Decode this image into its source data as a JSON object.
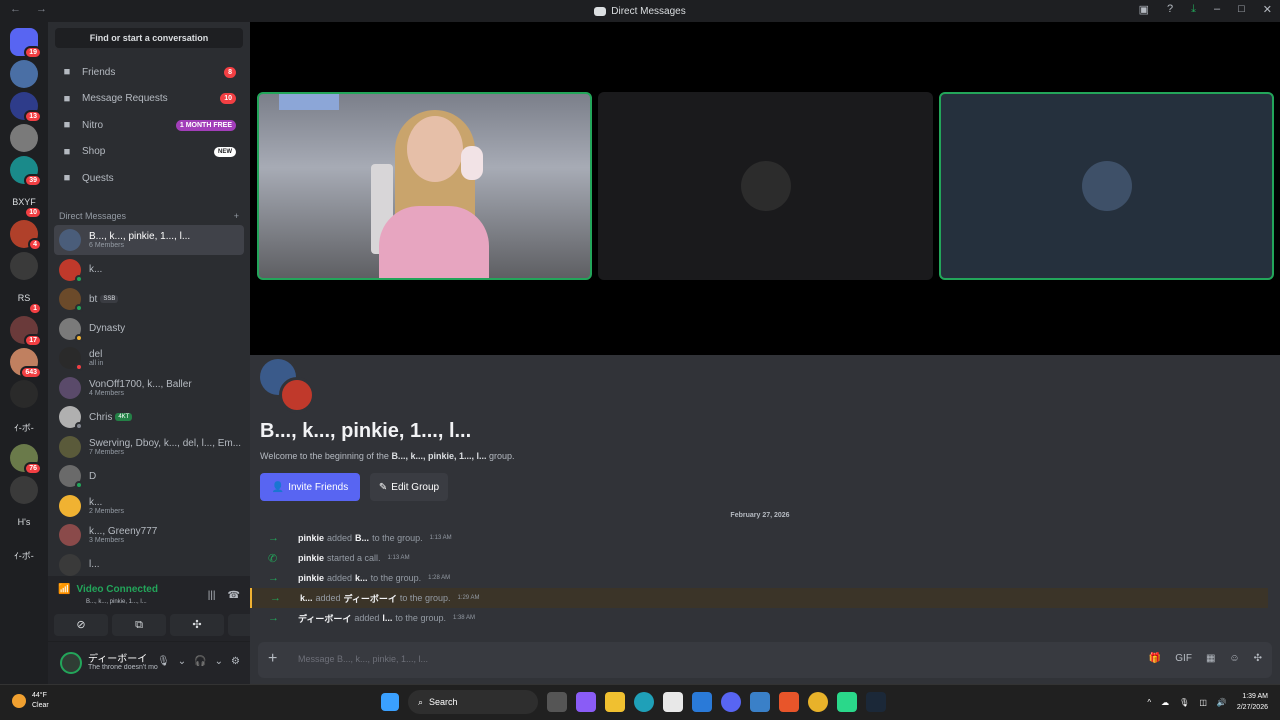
{
  "window": {
    "title": "Direct Messages"
  },
  "servers": [
    {
      "badge": "19"
    },
    {
      "badge": ""
    },
    {
      "badge": "13"
    },
    {
      "badge": ""
    },
    {
      "badge": "39"
    },
    {
      "text": "BXYF",
      "badge": "10"
    },
    {
      "badge": "4"
    },
    {
      "badge": ""
    },
    {
      "text": "RS",
      "badge": "1"
    },
    {
      "badge": "17"
    },
    {
      "badge": "643"
    },
    {
      "badge": ""
    },
    {
      "text": "ｲ-ボ-"
    },
    {
      "badge": "76"
    },
    {
      "badge": ""
    },
    {
      "text": "H's"
    },
    {
      "text": "ｲ-ボ-"
    }
  ],
  "sidebar": {
    "search": "Find or start a conversation",
    "nav": [
      {
        "label": "Friends",
        "badge": "8",
        "badge_type": "red",
        "icon": "friends-icon"
      },
      {
        "label": "Message Requests",
        "badge": "10",
        "badge_type": "red",
        "icon": "mail-icon"
      },
      {
        "label": "Nitro",
        "badge": "1 MONTH FREE",
        "badge_type": "purple",
        "icon": "nitro-icon"
      },
      {
        "label": "Shop",
        "badge": "NEW",
        "badge_type": "white",
        "icon": "shop-icon"
      },
      {
        "label": "Quests",
        "badge": "",
        "badge_type": "",
        "icon": "quests-icon"
      }
    ],
    "dm_header": "Direct Messages",
    "dms": [
      {
        "name": "B..., k..., pinkie, 1..., l...",
        "sub": "6 Members",
        "color": "#4a5d7a",
        "status": "",
        "tag": "",
        "active": true
      },
      {
        "name": "k...",
        "sub": "",
        "color": "#c0392b",
        "status": "#23a55a",
        "tag": ""
      },
      {
        "name": "bt",
        "sub": "",
        "color": "#6b4a2a",
        "status": "#23a55a",
        "tag": "SSB"
      },
      {
        "name": "Dynasty",
        "sub": "",
        "color": "#7a7a7a",
        "status": "#f0b232",
        "tag": ""
      },
      {
        "name": "del",
        "sub": "all in",
        "color": "#2a2a2a",
        "status": "#f23f43",
        "tag": ""
      },
      {
        "name": "VonOff1700, k..., Baller",
        "sub": "4 Members",
        "color": "#5a4a6a",
        "status": "",
        "tag": ""
      },
      {
        "name": "Chris",
        "sub": "",
        "color": "#b0b0b0",
        "status": "#80848e",
        "tag": "4KT"
      },
      {
        "name": "Swerving, Dboy, k..., del, l..., Em...",
        "sub": "7 Members",
        "color": "#5a5a3a",
        "status": "",
        "tag": ""
      },
      {
        "name": "D",
        "sub": "",
        "color": "#6a6a6a",
        "status": "#23a55a",
        "tag": ""
      },
      {
        "name": "k...",
        "sub": "2 Members",
        "color": "#f0b232",
        "status": "",
        "tag": ""
      },
      {
        "name": "k..., Greeny777",
        "sub": "3 Members",
        "color": "#8a4a4a",
        "status": "",
        "tag": ""
      },
      {
        "name": "l...",
        "sub": "",
        "color": "#3a3a3a",
        "status": "",
        "tag": ""
      }
    ]
  },
  "voice": {
    "status": "Video Connected",
    "channel": "B..., k..., pinkie, 1..., l..."
  },
  "user": {
    "name": "ディーボーイ",
    "status": "The throne doesn't mo"
  },
  "group": {
    "title": "B..., k..., pinkie, 1..., l...",
    "welcome_prefix": "Welcome to the beginning of the",
    "welcome_name": "B..., k..., pinkie, 1..., l...",
    "welcome_suffix": "group.",
    "invite": "Invite Friends",
    "edit": "Edit Group",
    "date": "February 27, 2026"
  },
  "messages": [
    {
      "actor": "pinkie",
      "verb": "added",
      "target": "B...",
      "rest": "to the group.",
      "time": "1:13 AM",
      "icon": "arrow",
      "hl": false
    },
    {
      "actor": "pinkie",
      "verb": "started a call.",
      "target": "",
      "rest": "",
      "time": "1:13 AM",
      "icon": "phone",
      "hl": false
    },
    {
      "actor": "pinkie",
      "verb": "added",
      "target": "k...",
      "rest": "to the group.",
      "time": "1:28 AM",
      "icon": "arrow",
      "hl": false
    },
    {
      "actor": "k...",
      "verb": "added",
      "target": "ディーボーイ",
      "rest": "to the group.",
      "time": "1:29 AM",
      "icon": "arrow",
      "hl": true
    },
    {
      "actor": "ディーボーイ",
      "verb": "added",
      "target": "l...",
      "rest": "to the group.",
      "time": "1:38 AM",
      "icon": "arrow",
      "hl": false
    }
  ],
  "composer": {
    "placeholder": "Message B..., k..., pinkie, 1..., l..."
  },
  "taskbar": {
    "temp": "44°F",
    "weather": "Clear",
    "search": "Search",
    "time": "1:39 AM",
    "date": "2/27/2026"
  }
}
